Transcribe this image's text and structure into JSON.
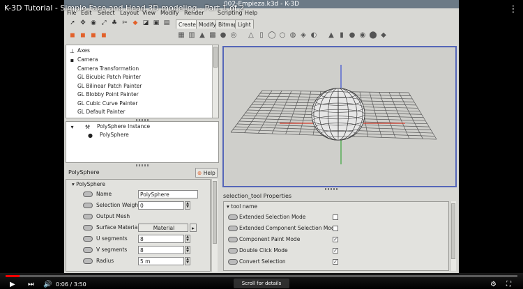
{
  "video": {
    "title": "K-3D Tutorial - Simple Face and Head 3D modeling - Part 1 of 2",
    "time_current": "0:06",
    "time_total": "3:50",
    "time_separator": "/",
    "progress_fraction": 0.027,
    "scroll_hint": "Scroll for details"
  },
  "window": {
    "title": "002-Empieza.k3d - K-3D",
    "menus": [
      "File",
      "Edit",
      "Select",
      "Layout",
      "View",
      "Modify",
      "Render",
      "Scripting",
      "Help"
    ]
  },
  "toolbar": {
    "tabs": [
      "Create",
      "Modify",
      "Bitmap",
      "Light"
    ],
    "active_tab": "Create"
  },
  "node_list": {
    "items": [
      "Axes",
      "Camera",
      "Camera Transformation",
      "GL Bicubic Patch Painter",
      "GL Bilinear Patch Painter",
      "GL Blobby Point Painter",
      "GL Cubic Curve Painter",
      "GL Default Painter"
    ]
  },
  "pipeline": {
    "parent": "PolySphere Instance",
    "child": "PolySphere"
  },
  "properties": {
    "title": "PolySphere",
    "help_label": "Help",
    "group": "PolySphere",
    "rows": [
      {
        "label": "Name",
        "value": "PolySphere"
      },
      {
        "label": "Selection Weight",
        "value": "0"
      },
      {
        "label": "Output Mesh",
        "value": ""
      },
      {
        "label": "Surface Material",
        "value": "Material"
      },
      {
        "label": "U segments",
        "value": "8"
      },
      {
        "label": "V segments",
        "value": "8"
      },
      {
        "label": "Radius",
        "value": "5 m"
      }
    ]
  },
  "selection_tool": {
    "title": "selection_tool Properties",
    "group": "tool name",
    "rows": [
      {
        "label": "Extended Selection Mode",
        "checked": false
      },
      {
        "label": "Extended Component Selection Mode",
        "checked": false
      },
      {
        "label": "Component Paint Mode",
        "checked": true
      },
      {
        "label": "Double Click Mode",
        "checked": true
      },
      {
        "label": "Convert Selection",
        "checked": true
      }
    ]
  },
  "colors": {
    "viewport_border": "#5566b8",
    "axis_x": "#d23a2a",
    "axis_y": "#3aa53a",
    "axis_z": "#3a4fd2",
    "progress": "#ff0000"
  }
}
